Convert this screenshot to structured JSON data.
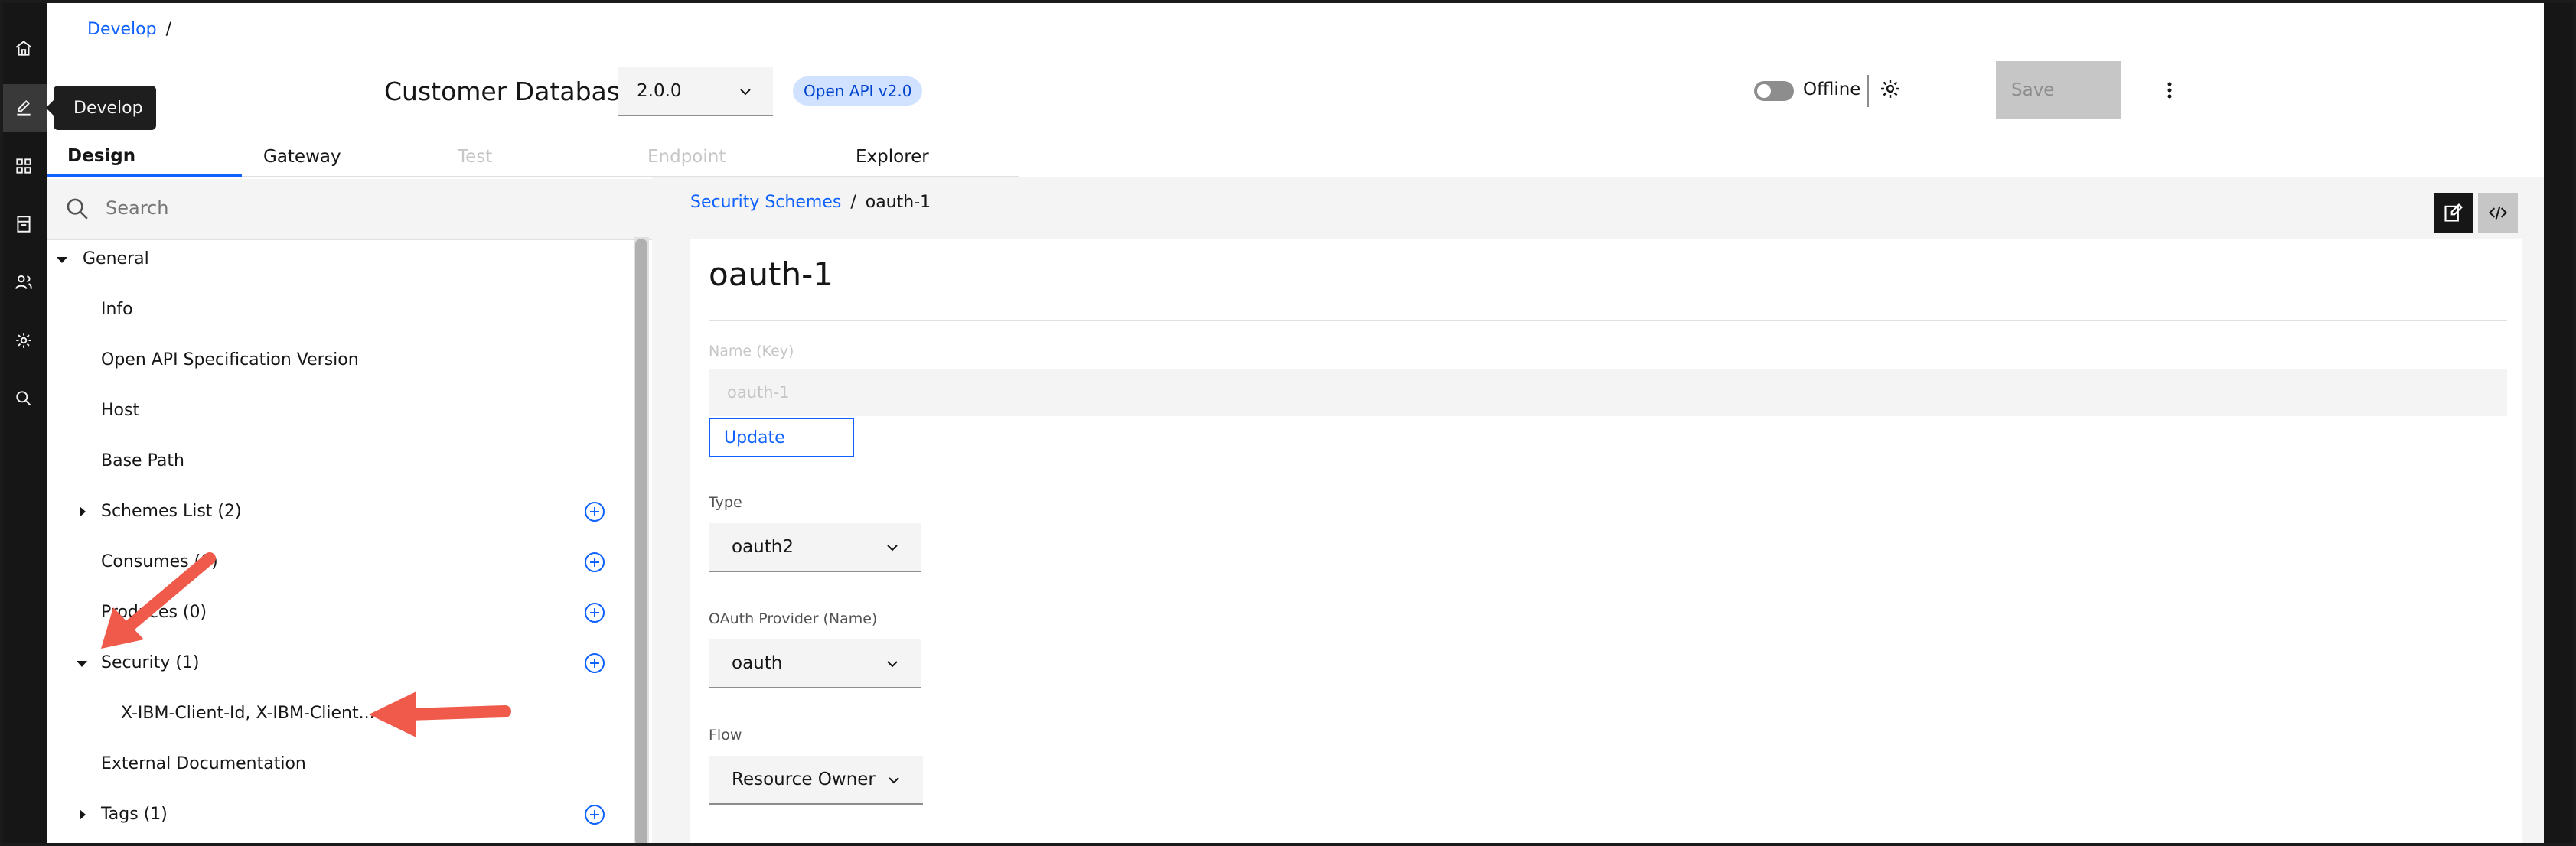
{
  "top_breadcrumb": {
    "develop": "Develop",
    "separator": "/"
  },
  "tooltip": {
    "text": "Develop"
  },
  "rail": {
    "items": [
      {
        "icon": "home-icon"
      },
      {
        "icon": "edit-icon",
        "active": true
      },
      {
        "icon": "apps-icon"
      },
      {
        "icon": "catalog-icon"
      },
      {
        "icon": "users-icon"
      },
      {
        "icon": "gear-icon"
      },
      {
        "icon": "search-icon"
      }
    ]
  },
  "header": {
    "api_title": "Customer Database",
    "version": "2.0.0",
    "tag": "Open API v2.0",
    "offline_label": "Offline",
    "save_label": "Save"
  },
  "tabs": [
    {
      "label": "Design",
      "state": "active"
    },
    {
      "label": "Gateway",
      "state": "normal"
    },
    {
      "label": "Test",
      "state": "disabled"
    },
    {
      "label": "Endpoint",
      "state": "disabled"
    },
    {
      "label": "Explorer",
      "state": "normal"
    }
  ],
  "search": {
    "placeholder": "Search"
  },
  "tree": {
    "general": "General",
    "info": "Info",
    "openapi_version": "Open API Specification Version",
    "host": "Host",
    "base_path": "Base Path",
    "schemes_list": "Schemes List (2)",
    "consumes": "Consumes (0)",
    "produces": "Produces (0)",
    "security": "Security (1)",
    "security_child": "X-IBM-Client-Id, X-IBM-Client...",
    "external_docs": "External Documentation",
    "tags": "Tags (1)"
  },
  "content": {
    "breadcrumb_parent": "Security Schemes",
    "breadcrumb_separator": "/",
    "breadcrumb_current": "oauth-1",
    "title": "oauth-1",
    "name_label": "Name (Key)",
    "name_value": "oauth-1",
    "update_label": "Update",
    "type_label": "Type",
    "type_value": "oauth2",
    "provider_label": "OAuth Provider (Name)",
    "provider_value": "oauth",
    "flow_label": "Flow",
    "flow_value": "Resource Owner"
  },
  "colors": {
    "link": "#0f62fe",
    "rail": "#161616",
    "annotation_arrow": "#f05a4a"
  }
}
